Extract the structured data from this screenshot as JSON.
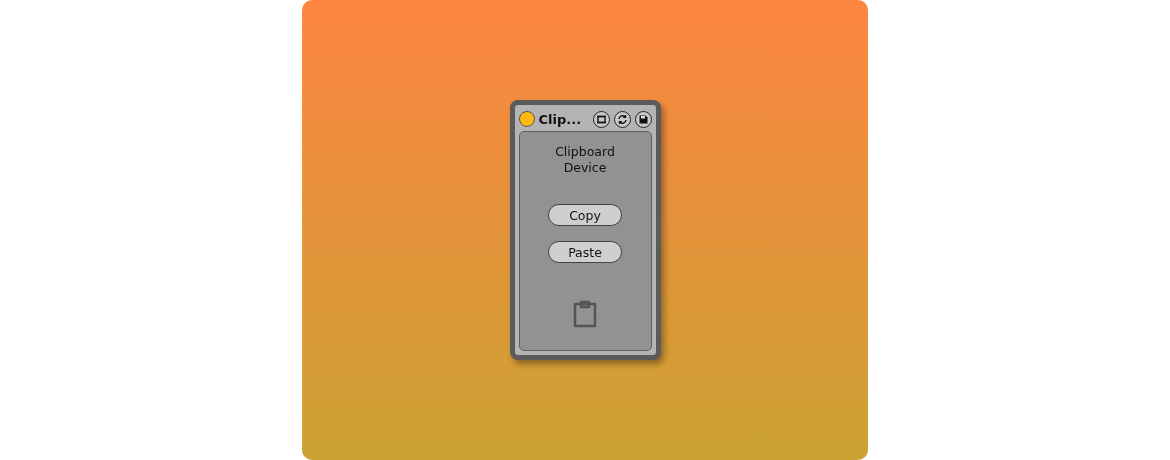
{
  "device": {
    "title": "Clip...",
    "on": true,
    "header_buttons": [
      {
        "kind": "fold"
      },
      {
        "kind": "sync"
      },
      {
        "kind": "save"
      }
    ]
  },
  "panel": {
    "title": "Clipboard\nDevice",
    "buttons": [
      "Copy",
      "Paste"
    ]
  }
}
